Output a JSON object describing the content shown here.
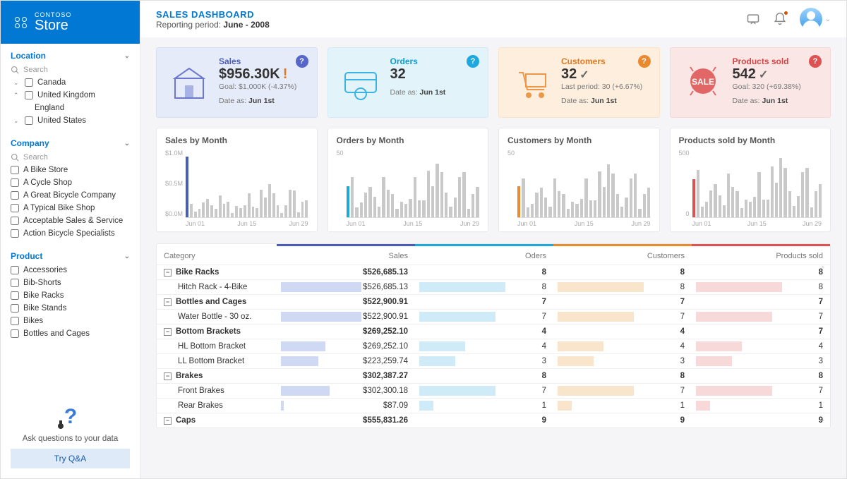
{
  "brand": {
    "sub": "CONTOSO",
    "main": "Store"
  },
  "header": {
    "title": "SALES DASHBOARD",
    "period_label": "Reporting period: ",
    "period_value": "June - 2008"
  },
  "filters": {
    "location": {
      "title": "Location",
      "search_placeholder": "Search",
      "items": [
        {
          "label": "Canada",
          "expanded": false
        },
        {
          "label": "United Kingdom",
          "expanded": true,
          "children": [
            "England"
          ]
        },
        {
          "label": "United States",
          "expanded": false
        }
      ]
    },
    "company": {
      "title": "Company",
      "search_placeholder": "Search",
      "items": [
        "A Bike Store",
        "A Cycle Shop",
        "A Great Bicycle Company",
        "A Typical Bike Shop",
        "Acceptable Sales & Service",
        "Action Bicycle Specialists"
      ]
    },
    "product": {
      "title": "Product",
      "items": [
        "Accessories",
        "Bib-Shorts",
        "Bike Racks",
        "Bike Stands",
        "Bikes",
        "Bottles and Cages"
      ]
    }
  },
  "qa": {
    "text": "Ask questions to your data",
    "button": "Try Q&A"
  },
  "kpi": [
    {
      "label": "Sales",
      "value": "$956.30K",
      "badge": "!",
      "sub": "Goal: $1,000K (-4.37%)",
      "date_label": "Date as:",
      "date": "Jun 1st"
    },
    {
      "label": "Orders",
      "value": "32",
      "badge": "",
      "sub": "",
      "date_label": "Date as:",
      "date": "Jun 1st"
    },
    {
      "label": "Customers",
      "value": "32",
      "badge": "✓",
      "sub": "Last period: 30 (+6.67%)",
      "date_label": "Date as:",
      "date": "Jun 1st"
    },
    {
      "label": "Products sold",
      "value": "542",
      "badge": "✓",
      "sub": "Goal: 320 (+69.38%)",
      "date_label": "Date as:",
      "date": "Jun 1st"
    }
  ],
  "chart_titles": [
    "Sales by Month",
    "Orders by Month",
    "Customers by Month",
    "Products sold by Month"
  ],
  "chart_x": [
    "Jun 01",
    "Jun 15",
    "Jun 29"
  ],
  "chart_y": [
    [
      "$1.0M",
      "$0.5M",
      "$0.0M"
    ],
    [
      "50",
      ""
    ],
    [
      "50",
      ""
    ],
    [
      "500",
      "0"
    ]
  ],
  "table": {
    "headers": [
      "Category",
      "Sales",
      "Oders",
      "Customers",
      "Products sold"
    ],
    "rows": [
      {
        "type": "cat",
        "name": "Bike Racks",
        "sales": "$526,685.13",
        "orders": "8",
        "cust": "8",
        "prod": "8"
      },
      {
        "type": "sub",
        "name": "Hitch Rack - 4-Bike",
        "sales": "$526,685.13",
        "orders": "8",
        "cust": "8",
        "prod": "8",
        "bw": [
          58,
          62,
          62,
          62
        ]
      },
      {
        "type": "cat",
        "name": "Bottles and Cages",
        "sales": "$522,900.91",
        "orders": "7",
        "cust": "7",
        "prod": "7"
      },
      {
        "type": "sub",
        "name": "Water Bottle - 30 oz.",
        "sales": "$522,900.91",
        "orders": "7",
        "cust": "7",
        "prod": "7",
        "bw": [
          58,
          55,
          55,
          55
        ]
      },
      {
        "type": "cat",
        "name": "Bottom Brackets",
        "sales": "$269,252.10",
        "orders": "4",
        "cust": "4",
        "prod": "7"
      },
      {
        "type": "sub",
        "name": "HL Bottom Bracket",
        "sales": "$269,252.10",
        "orders": "4",
        "cust": "4",
        "prod": "4",
        "bw": [
          32,
          33,
          33,
          33
        ]
      },
      {
        "type": "sub",
        "name": "LL Bottom Bracket",
        "sales": "$223,259.74",
        "orders": "3",
        "cust": "3",
        "prod": "3",
        "bw": [
          27,
          26,
          26,
          26
        ]
      },
      {
        "type": "cat",
        "name": "Brakes",
        "sales": "$302,387.27",
        "orders": "8",
        "cust": "8",
        "prod": "8"
      },
      {
        "type": "sub",
        "name": "Front Brakes",
        "sales": "$302,300.18",
        "orders": "7",
        "cust": "7",
        "prod": "7",
        "bw": [
          35,
          55,
          55,
          55
        ]
      },
      {
        "type": "sub",
        "name": "Rear Brakes",
        "sales": "$87.09",
        "orders": "1",
        "cust": "1",
        "prod": "1",
        "bw": [
          2,
          10,
          10,
          10
        ]
      },
      {
        "type": "cat",
        "name": "Caps",
        "sales": "$555,831.26",
        "orders": "9",
        "cust": "9",
        "prod": "9"
      }
    ]
  },
  "chart_data": [
    {
      "type": "bar",
      "title": "Sales by Month",
      "xlabel": "",
      "ylabel": "",
      "ylim": [
        0,
        1000000
      ],
      "categories_note": "daily Jun 01–Jun 30",
      "values": [
        960000,
        210000,
        90000,
        130000,
        230000,
        290000,
        190000,
        130000,
        340000,
        210000,
        240000,
        70000,
        180000,
        150000,
        190000,
        380000,
        170000,
        140000,
        430000,
        310000,
        520000,
        380000,
        190000,
        70000,
        190000,
        430000,
        420000,
        80000,
        240000,
        270000
      ],
      "highlight_index": 0
    },
    {
      "type": "bar",
      "title": "Orders by Month",
      "xlabel": "",
      "ylabel": "",
      "ylim": [
        0,
        65
      ],
      "values": [
        32,
        41,
        10,
        15,
        25,
        31,
        21,
        11,
        41,
        28,
        24,
        9,
        16,
        14,
        19,
        41,
        17,
        17,
        48,
        32,
        55,
        46,
        25,
        11,
        20,
        41,
        46,
        9,
        24,
        31
      ],
      "highlight_index": 0
    },
    {
      "type": "bar",
      "title": "Customers by Month",
      "xlabel": "",
      "ylabel": "",
      "ylim": [
        0,
        65
      ],
      "values": [
        32,
        40,
        10,
        14,
        25,
        30,
        20,
        11,
        40,
        27,
        24,
        9,
        16,
        14,
        19,
        40,
        17,
        17,
        47,
        31,
        54,
        45,
        24,
        11,
        20,
        40,
        45,
        9,
        24,
        30
      ],
      "highlight_index": 0
    },
    {
      "type": "bar",
      "title": "Products sold by Month",
      "xlabel": "",
      "ylabel": "",
      "ylim": [
        0,
        900
      ],
      "values": [
        542,
        670,
        150,
        220,
        380,
        470,
        310,
        170,
        620,
        430,
        370,
        130,
        250,
        220,
        290,
        640,
        250,
        250,
        720,
        490,
        840,
        700,
        370,
        160,
        300,
        640,
        700,
        140,
        370,
        470
      ],
      "highlight_index": 0
    }
  ]
}
